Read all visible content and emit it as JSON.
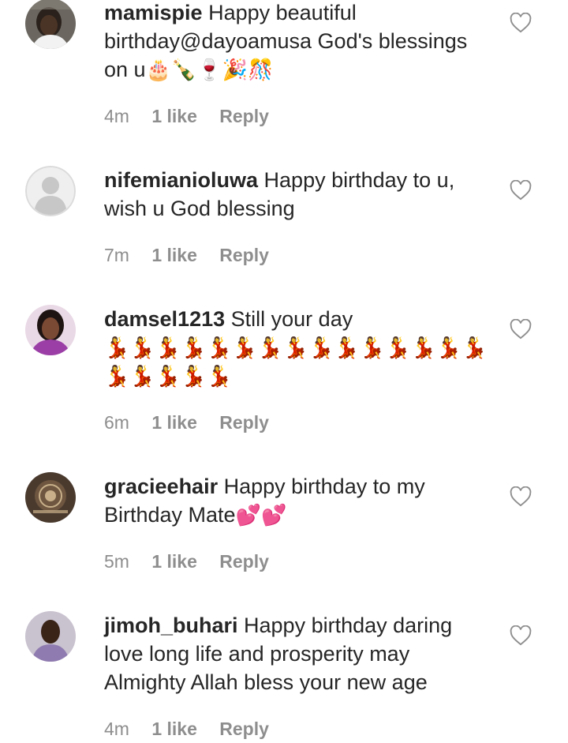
{
  "comments": [
    {
      "username": "mamispie",
      "text": "Happy beautiful birthday@dayoamusa God's blessings on u",
      "emojis": "🎂🍾🍷🎉🎊",
      "time": "4m",
      "likes": "1 like",
      "reply": "Reply"
    },
    {
      "username": "nifemianioluwa",
      "text": "Happy birthday to u, wish u God blessing",
      "emojis": "",
      "time": "7m",
      "likes": "1 like",
      "reply": "Reply"
    },
    {
      "username": "damsel1213",
      "text": "Still your day",
      "emojis": "💃💃💃💃💃💃💃💃💃💃💃💃💃💃💃💃💃💃💃💃",
      "time": "6m",
      "likes": "1 like",
      "reply": "Reply"
    },
    {
      "username": "gracieehair",
      "text": "Happy birthday to my Birthday Mate",
      "emojis": "💕💕",
      "time": "5m",
      "likes": "1 like",
      "reply": "Reply"
    },
    {
      "username": "jimoh_buhari",
      "text": "Happy birthday daring love long life and prosperity may Almighty Allah bless your new age",
      "emojis": "",
      "time": "4m",
      "likes": "1 like",
      "reply": "Reply"
    }
  ],
  "icons": {
    "like": "heart-outline-icon",
    "avatar_placeholder": "person-placeholder-icon"
  },
  "colors": {
    "text": "#262626",
    "meta": "#8e8e8e",
    "heart_stroke": "#8e8e8e"
  }
}
